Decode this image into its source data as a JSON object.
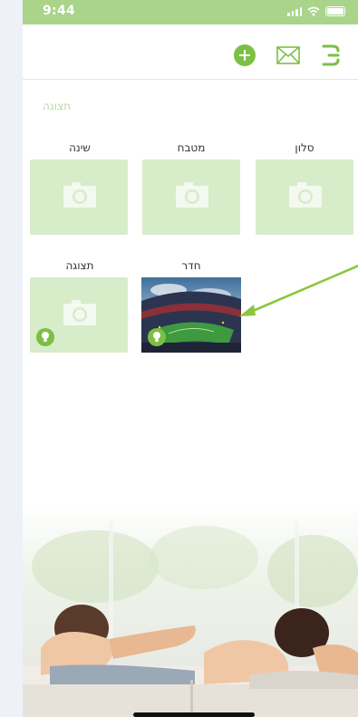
{
  "status_bar": {
    "time": "9:44"
  },
  "toolbar": {
    "add_icon": "plus-circle-icon",
    "mail_icon": "envelope-icon",
    "menu_icon": "menu-icon"
  },
  "section": {
    "title": "תצוגה"
  },
  "rooms": [
    {
      "label": "סלון",
      "icon": "camera-icon"
    },
    {
      "label": "מטבח",
      "icon": "camera-icon"
    },
    {
      "label": "שינה",
      "icon": "camera-icon"
    },
    {
      "label": "חדר",
      "icon": "stadium-photo",
      "has_bulb": true
    },
    {
      "label": "תצוגה",
      "icon": "camera-icon",
      "has_bulb": true
    }
  ],
  "colors": {
    "accent": "#7cbf45",
    "status_bar": "#a9d48a",
    "tile": "#d7ecc9",
    "arrow": "#8cc63f"
  }
}
